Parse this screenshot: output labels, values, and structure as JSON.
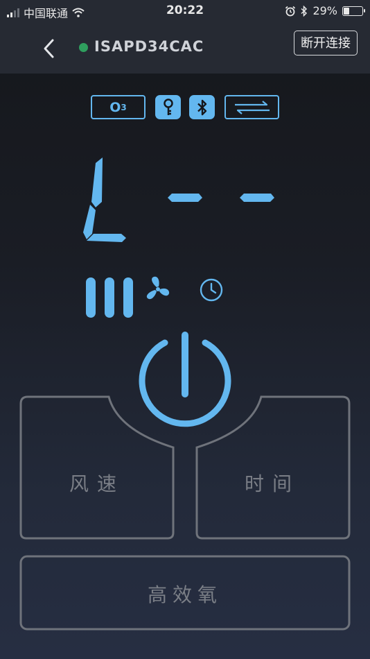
{
  "status_bar": {
    "carrier": "中国联通",
    "time": "20:22",
    "battery_percent": "29%",
    "battery_level": 0.29,
    "icons": [
      "signal-icon",
      "wifi-icon",
      "alarm-icon",
      "bluetooth-icon",
      "battery-icon"
    ]
  },
  "nav": {
    "back_icon": "chevron-left-icon",
    "device_name": "ISAPD34CAC",
    "connection_status_color": "#2f9e5e",
    "disconnect_label": "断开连接"
  },
  "indicators": {
    "ozone_label": "O",
    "ozone_sub": "3",
    "lock_icon": "key-icon",
    "bluetooth_icon": "bluetooth-icon",
    "swap_icon": "swap-arrows-icon"
  },
  "display": {
    "segments": "L - -",
    "fan_speed_bars": 3,
    "fan_icon": "fan-icon",
    "timer_icon": "clock-icon"
  },
  "controls": {
    "power_icon": "power-icon",
    "speed_label": "风速",
    "time_label": "时间",
    "oxygen_label": "高效氧"
  },
  "colors": {
    "accent": "#63b7ef",
    "button_border": "#6f737b",
    "label": "#7a7e86"
  }
}
